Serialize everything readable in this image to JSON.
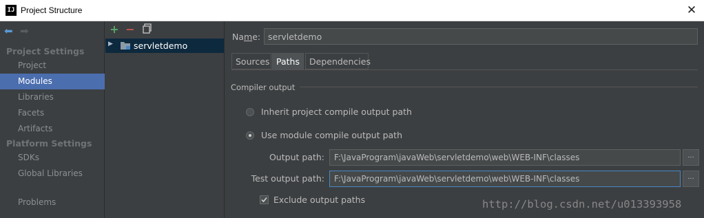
{
  "window": {
    "title": "Project Structure",
    "app_icon_text": "IJ",
    "close_icon": "close-icon"
  },
  "left": {
    "project_settings_header": "Project Settings",
    "project_items": [
      "Project",
      "Modules",
      "Libraries",
      "Facets",
      "Artifacts"
    ],
    "platform_settings_header": "Platform Settings",
    "platform_items": [
      "SDKs",
      "Global Libraries"
    ],
    "problems": "Problems",
    "selected": "Modules"
  },
  "middle": {
    "module_name": "servletdemo"
  },
  "right": {
    "name_label_pre": "Na",
    "name_label_u": "m",
    "name_label_post": "e:",
    "name_value": "servletdemo",
    "tabs": [
      "Sources",
      "Paths",
      "Dependencies"
    ],
    "active_tab": "Paths",
    "compiler_output_title": "Compiler output",
    "inherit_option": "Inherit project compile output path",
    "use_module_option": "Use module compile output path",
    "output_path_label": "Output path:",
    "output_path_value": "F:\\JavaProgram\\javaWeb\\servletdemo\\web\\WEB-INF\\classes",
    "test_output_path_label": "Test output path:",
    "test_output_path_value": "F:\\JavaProgram\\javaWeb\\servletdemo\\web\\WEB-INF\\classes",
    "browse_label": "...",
    "exclude_label": "Exclude output paths",
    "exclude_checked": true
  },
  "watermark": "http://blog.csdn.net/u013393958",
  "colors": {
    "background": "#3c3f41",
    "selection": "#4b6eaf",
    "tree_selection": "#0d293e",
    "add": "#59a869",
    "remove": "#c75450"
  }
}
